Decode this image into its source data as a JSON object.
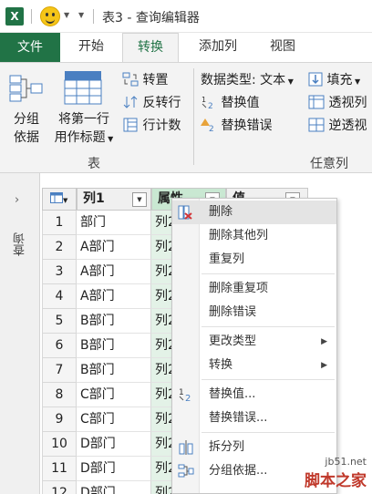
{
  "window": {
    "app_logo": "X",
    "title": "表3 - 查询编辑器"
  },
  "tabs": [
    {
      "label": "文件"
    },
    {
      "label": "开始"
    },
    {
      "label": "转换"
    },
    {
      "label": "添加列"
    },
    {
      "label": "视图"
    }
  ],
  "ribbon": {
    "table_group": {
      "group_by_line1": "分组",
      "group_by_line2": "依据",
      "first_row_line1": "将第一行",
      "first_row_line2": "用作标题",
      "transpose": "转置",
      "reverse_rows": "反转行",
      "count_rows": "行计数",
      "label": "表"
    },
    "any_column_group": {
      "data_type": "数据类型: 文本",
      "fill": "填充",
      "replace_values": "替换值",
      "pivot_column": "透视列",
      "replace_errors": "替换错误",
      "unpivot_columns": "逆透视",
      "label": "任意列"
    }
  },
  "left_pane": {
    "label": "查询",
    "arrow": "›"
  },
  "grid": {
    "columns": [
      "列1",
      "属性",
      "值"
    ],
    "rows": [
      {
        "num": "1",
        "col1": "部门",
        "col2": "列2"
      },
      {
        "num": "2",
        "col1": "A部门",
        "col2": "列2"
      },
      {
        "num": "3",
        "col1": "A部门",
        "col2": "列2"
      },
      {
        "num": "4",
        "col1": "A部门",
        "col2": "列2"
      },
      {
        "num": "5",
        "col1": "B部门",
        "col2": "列2"
      },
      {
        "num": "6",
        "col1": "B部门",
        "col2": "列2"
      },
      {
        "num": "7",
        "col1": "B部门",
        "col2": "列2"
      },
      {
        "num": "8",
        "col1": "C部门",
        "col2": "列2"
      },
      {
        "num": "9",
        "col1": "C部门",
        "col2": "列2"
      },
      {
        "num": "10",
        "col1": "D部门",
        "col2": "列2"
      },
      {
        "num": "11",
        "col1": "D部门",
        "col2": "列2"
      },
      {
        "num": "12",
        "col1": "D部门",
        "col2": "列2"
      }
    ]
  },
  "context_menu": {
    "items": [
      {
        "label": "删除"
      },
      {
        "label": "删除其他列"
      },
      {
        "label": "重复列"
      },
      {
        "label": "删除重复项"
      },
      {
        "label": "删除错误"
      },
      {
        "label": "更改类型"
      },
      {
        "label": "转换"
      },
      {
        "label": "替换值..."
      },
      {
        "label": "替换错误..."
      },
      {
        "label": "拆分列"
      },
      {
        "label": "分组依据..."
      }
    ]
  },
  "watermark": {
    "url": "jb51.net",
    "name": "脚本之家"
  },
  "colors": {
    "accent": "#217346",
    "column_selected": "#c9e8d2",
    "menu_highlight": "#e4e4e4"
  }
}
